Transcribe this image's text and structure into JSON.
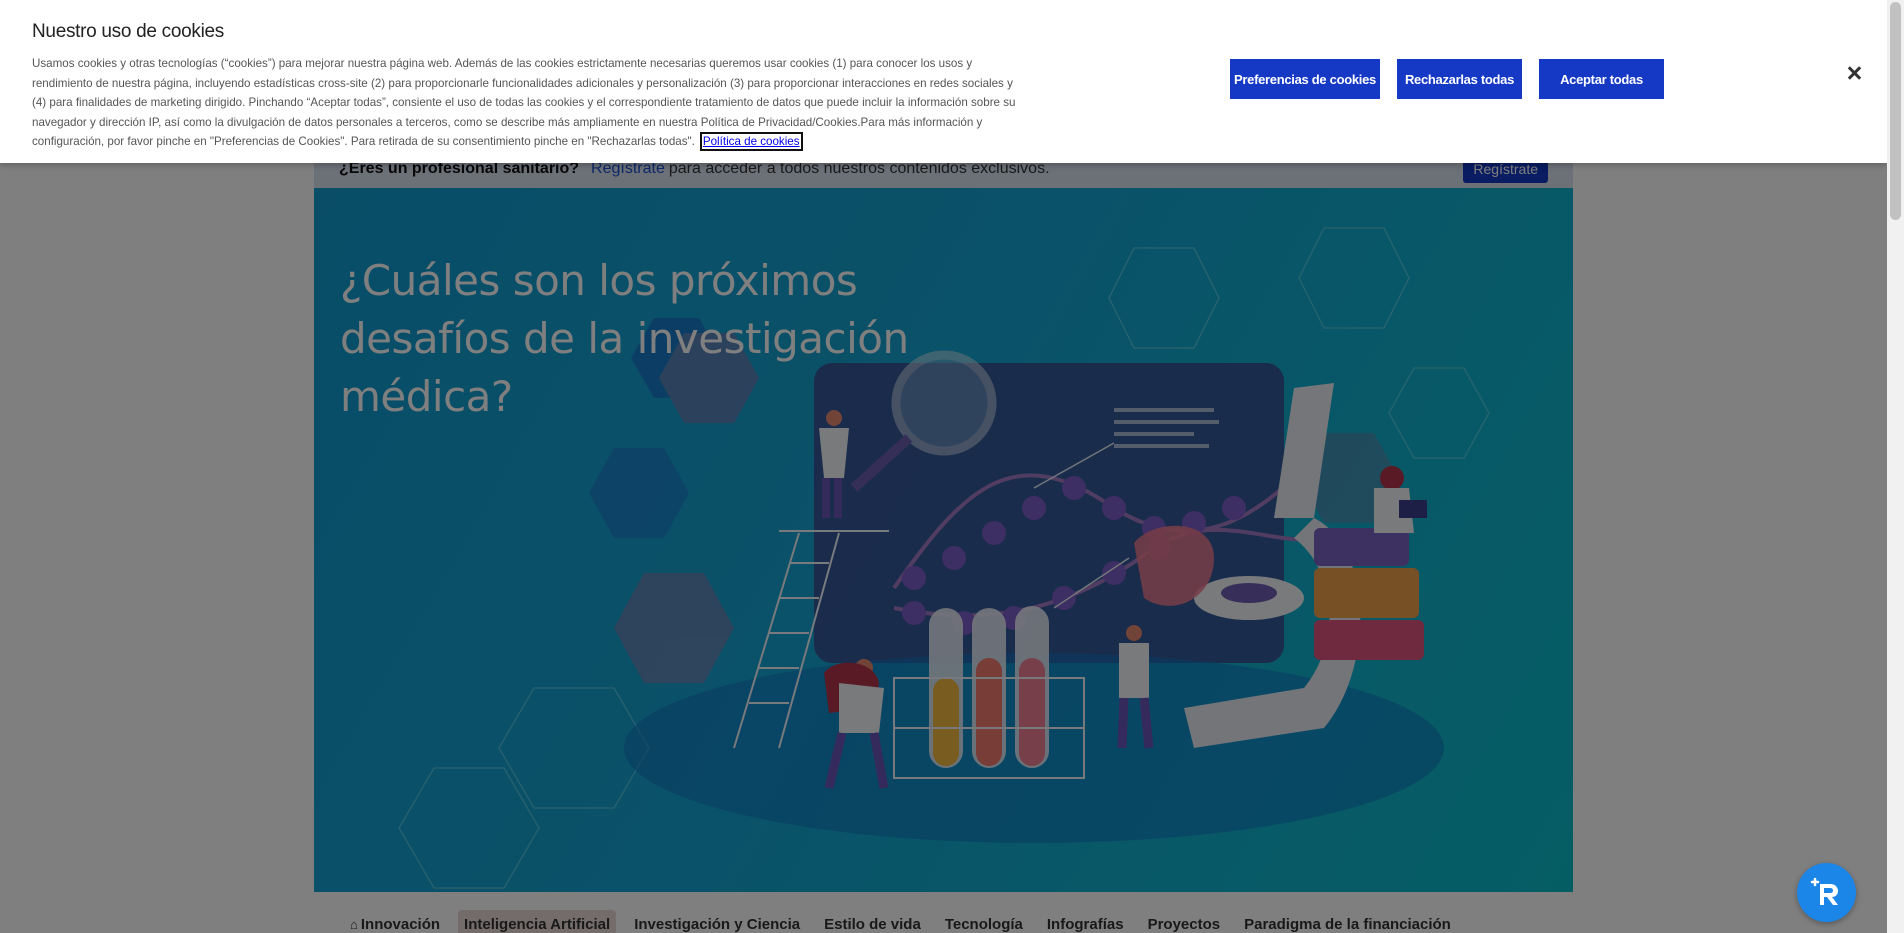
{
  "cookie_banner": {
    "title": "Nuestro uso de cookies",
    "description": "Usamos cookies y otras tecnologías (“cookies”) para mejorar nuestra página web. Además de las cookies estrictamente necesarias queremos usar cookies (1) para conocer los usos y rendimiento de nuestra página, incluyendo estadísticas cross-site (2) para proporcionarle funcionalidades adicionales y personalización (3) para proporcionar interacciones en redes sociales y (4) para finalidades de marketing dirigido. Pinchando “Aceptar todas”, consiente el uso de todas las cookies y el correspondiente tratamiento de datos que puede incluir la información sobre su navegador y dirección IP, así como la divulgación de datos personales a terceros, como se describe más ampliamente en nuestra Política de Privacidad/Cookies.Para más información y configuración, por favor pinche en \"Preferencias de Cookies\". Para retirada de su consentimiento pinche en \"Rechazarlas todas\".",
    "policy_link": "Política de cookies",
    "buttons": {
      "preferences": "Preferencias de cookies",
      "reject_all": "Rechazarlas todas",
      "accept_all": "Aceptar todas"
    },
    "close_icon": "close-icon"
  },
  "pro_bar": {
    "question": "¿Eres un profesional sanitario?",
    "register_link": "Regístrate",
    "rest_text": "para acceder a todos nuestros contenidos exclusivos.",
    "register_button": "Regístrate"
  },
  "hero": {
    "headline": "¿Cuáles son los próximos desafíos de la investigación médica?"
  },
  "nav": {
    "items": [
      {
        "label": "Innovación",
        "icon": "home-icon"
      },
      {
        "label": "Inteligencia Artificial",
        "active": true
      },
      {
        "label": "Investigación y Ciencia"
      },
      {
        "label": "Estilo de vida"
      },
      {
        "label": "Tecnología"
      },
      {
        "label": "Infografías"
      },
      {
        "label": "Proyectos"
      },
      {
        "label": "Paradigma de la financiación"
      }
    ]
  },
  "colors": {
    "brand_blue": "#1539c4",
    "hero_teal": "#14a4d2",
    "fab_blue": "#1b86e8"
  },
  "fab": {
    "icon": "chat-assistant-icon"
  }
}
